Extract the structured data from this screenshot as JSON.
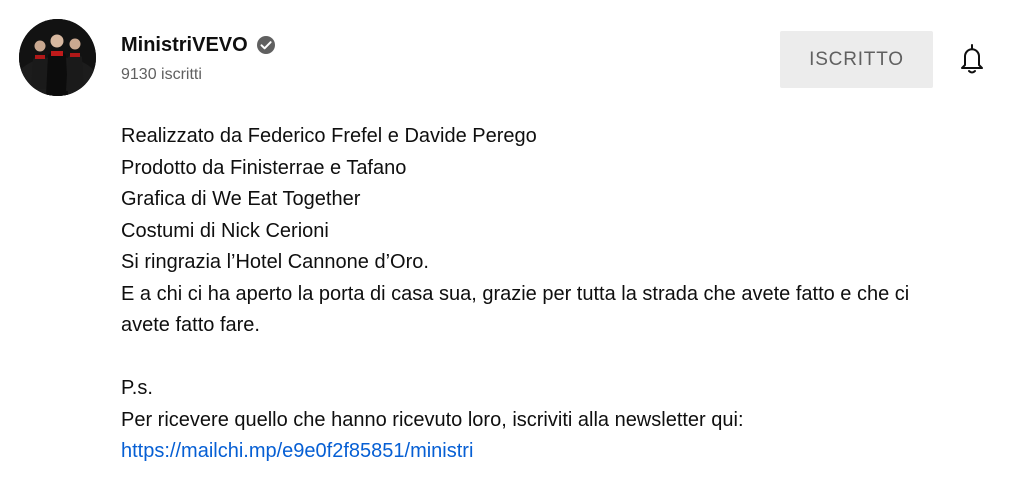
{
  "channel": {
    "name": "MinistriVEVO",
    "subscribers": "9130 iscritti",
    "verified_icon": "verified-check-icon"
  },
  "actions": {
    "subscribe_label": "ISCRITTO",
    "bell_icon": "notification-bell-icon"
  },
  "description": {
    "lines": [
      "Realizzato da Federico Frefel e Davide Perego",
      "Prodotto da Finisterrae e Tafano",
      "Grafica di We Eat Together",
      "Costumi di Nick Cerioni",
      "Si ringrazia l’Hotel Cannone d’Oro.",
      "E a chi ci ha aperto la porta di casa sua, grazie per tutta la strada che avete fatto e che ci",
      "avete fatto fare.",
      "P.s.",
      "Per ricevere quello che hanno ricevuto loro, iscriviti alla newsletter qui:"
    ],
    "link": "https://mailchi.mp/e9e0f2f85851/ministri"
  },
  "colors": {
    "link": "#065fd4",
    "secondary_text": "#606060",
    "button_bg": "#ececec"
  }
}
